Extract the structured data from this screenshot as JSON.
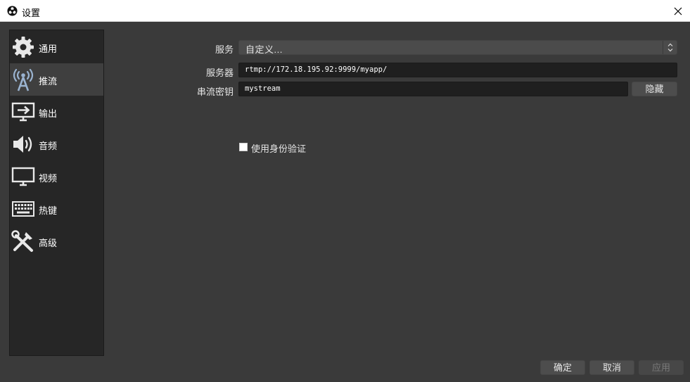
{
  "window": {
    "title": "设置",
    "app_icon": "obs-logo-icon",
    "close_icon": "close-icon"
  },
  "sidebar": {
    "items": [
      {
        "label": "通用",
        "icon": "gear-icon",
        "active": false
      },
      {
        "label": "推流",
        "icon": "broadcast-antenna-icon",
        "active": true
      },
      {
        "label": "输出",
        "icon": "output-monitor-icon",
        "active": false
      },
      {
        "label": "音频",
        "icon": "speaker-icon",
        "active": false
      },
      {
        "label": "视频",
        "icon": "monitor-icon",
        "active": false
      },
      {
        "label": "热键",
        "icon": "keyboard-icon",
        "active": false
      },
      {
        "label": "高级",
        "icon": "tools-icon",
        "active": false
      }
    ]
  },
  "stream": {
    "service_label": "服务",
    "service_value": "自定义...",
    "server_label": "服务器",
    "server_value": "rtmp://172.18.195.92:9999/myapp/",
    "key_label": "串流密钥",
    "key_value": "mystream",
    "hide_button": "隐藏",
    "auth_checkbox_label": "使用身份验证",
    "auth_checked": false
  },
  "footer": {
    "ok_label": "确定",
    "cancel_label": "取消",
    "apply_label": "应用"
  },
  "colors": {
    "background": "#3a3a3a",
    "sidebar": "#262626",
    "active_item": "#3f3f3f",
    "field": "#1f1f1f",
    "button": "#4d4d4d"
  }
}
